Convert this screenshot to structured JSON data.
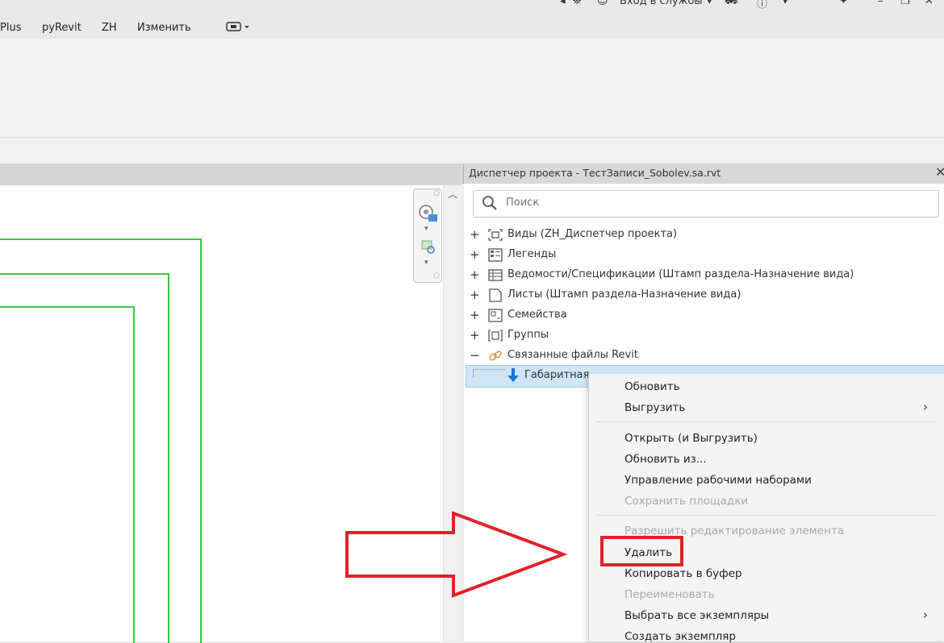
{
  "top": {
    "login_label": "Вход в службы"
  },
  "menu": {
    "items": [
      "Plus",
      "pyRevit",
      "ZH",
      "Изменить"
    ]
  },
  "browser": {
    "title": "Диспетчер проекта - ТестЗаписи_Sobolev.sa.rvt",
    "search_placeholder": "Поиск",
    "items": [
      {
        "expander": "+",
        "icon": "views-icon",
        "label": "Виды (ZH_Диспетчер проекта)"
      },
      {
        "expander": "+",
        "icon": "legends-icon",
        "label": "Легенды"
      },
      {
        "expander": "+",
        "icon": "schedules-icon",
        "label": "Ведомости/Спецификации (Штамп раздела-Назначение вида)"
      },
      {
        "expander": "+",
        "icon": "sheets-icon",
        "label": "Листы (Штамп раздела-Назначение вида)"
      },
      {
        "expander": "+",
        "icon": "families-icon",
        "label": "Семейства"
      },
      {
        "expander": "+",
        "icon": "groups-icon",
        "label": "Группы"
      },
      {
        "expander": "−",
        "icon": "link-icon",
        "label": "Связанные файлы Revit"
      }
    ],
    "selected_item": "Габаритная"
  },
  "context_menu": {
    "items": [
      {
        "label": "Обновить",
        "disabled": false,
        "submenu": false
      },
      {
        "label": "Выгрузить",
        "disabled": false,
        "submenu": true
      },
      {
        "label": "Открыть (и Выгрузить)",
        "disabled": false,
        "submenu": false
      },
      {
        "label": "Обновить из...",
        "disabled": false,
        "submenu": false
      },
      {
        "label": "Управление рабочими наборами",
        "disabled": false,
        "submenu": false
      },
      {
        "label": "Сохранить площадки",
        "disabled": true,
        "submenu": false
      },
      {
        "label": "Разрешить редактирование элемента",
        "disabled": true,
        "submenu": false
      },
      {
        "label": "Удалить",
        "disabled": false,
        "submenu": false,
        "highlighted": true
      },
      {
        "label": "Копировать в буфер",
        "disabled": false,
        "submenu": false
      },
      {
        "label": "Переименовать",
        "disabled": true,
        "submenu": false
      },
      {
        "label": "Выбрать все экземпляры",
        "disabled": false,
        "submenu": true
      },
      {
        "label": "Создать экземпляр",
        "disabled": false,
        "submenu": false
      }
    ]
  },
  "colors": {
    "annotation_red": "#e0222a",
    "link_lines": "#39c939",
    "selection": "#cfe6f6"
  }
}
